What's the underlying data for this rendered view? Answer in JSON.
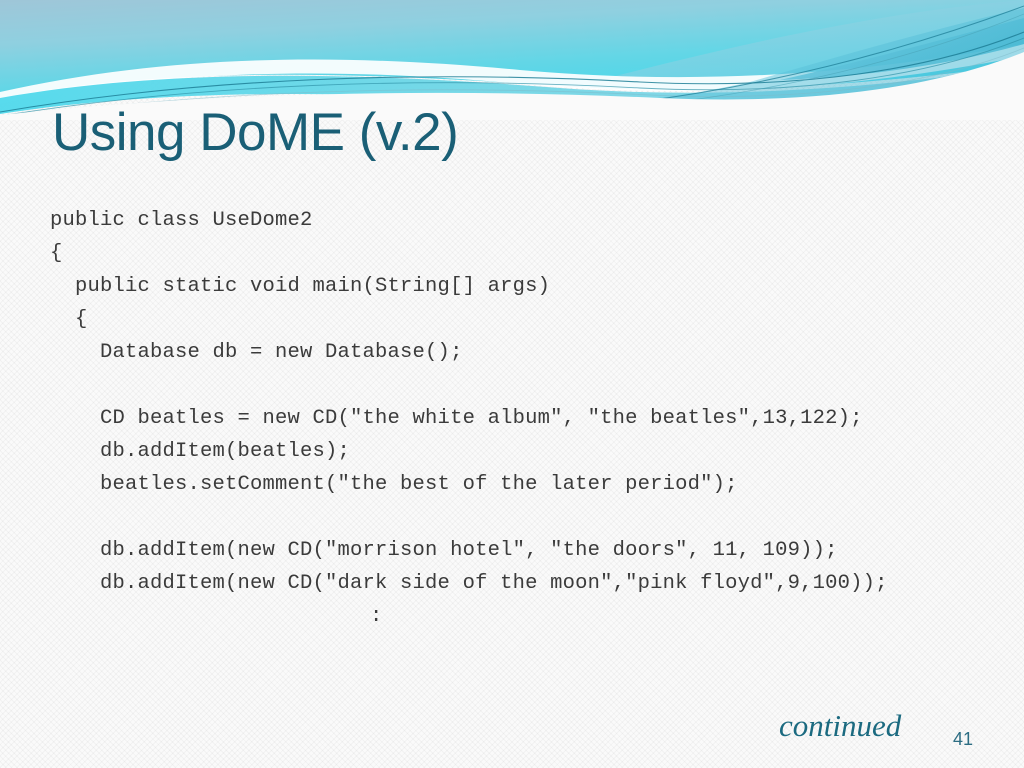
{
  "slide": {
    "title": "Using DoME (v.2)",
    "theme_name": "flow-banner",
    "colors": {
      "title": "#1a5f76",
      "code_text": "#3b3b3b",
      "accent_teal": "#1b6a80",
      "banner_cyan_light": "#5fd7e4",
      "banner_cyan_mid": "#6fc9dd",
      "banner_blue": "#8fc9e3",
      "banner_stripe": "#1b6a80",
      "background": "#fafafa"
    },
    "code_lines": [
      {
        "text": "public class UseDome2",
        "kind": "code"
      },
      {
        "text": "{",
        "kind": "code"
      },
      {
        "text": "  public static void main(String[] args)",
        "kind": "code"
      },
      {
        "text": "  {",
        "kind": "code"
      },
      {
        "text": "    Database db = new Database();",
        "kind": "code"
      },
      {
        "text": "",
        "kind": "blank"
      },
      {
        "text": "    CD beatles = new CD(\"the white album\", \"the beatles\",13,122);",
        "kind": "code"
      },
      {
        "text": "    db.addItem(beatles);",
        "kind": "code"
      },
      {
        "text": "    beatles.setComment(\"the best of the later period\");",
        "kind": "code"
      },
      {
        "text": "",
        "kind": "blank"
      },
      {
        "text": "    db.addItem(new CD(\"morrison hotel\", \"the doors\", 11, 109));",
        "kind": "code"
      },
      {
        "text": "    db.addItem(new CD(\"dark side of the moon\",\"pink floyd\",9,100));",
        "kind": "code"
      },
      {
        "text": ":",
        "kind": "colon"
      }
    ],
    "footer": {
      "continued_label": "continued",
      "slide_number": "41"
    }
  }
}
